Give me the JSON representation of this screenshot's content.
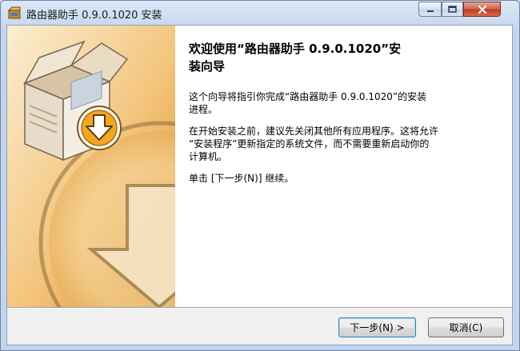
{
  "window": {
    "title": "路由器助手 0.9.0.1020 安装",
    "controls": [
      "minimize-icon",
      "maximize-icon",
      "close-icon"
    ]
  },
  "side_panel": {
    "image": "installer-box-with-download-arrow",
    "colors": {
      "bg_light": "#fbe6bd",
      "bg_dark": "#e2a54b",
      "arrow": "#e3a01e"
    }
  },
  "welcome": {
    "heading_line1": "欢迎使用“路由器助手 0.9.0.1020”安",
    "heading_line2": "装向导",
    "p1_line1": "这个向导将指引你完成“路由器助手 0.9.0.1020”的安装",
    "p1_line2": "进程。",
    "p2_line1": "在开始安装之前，建议先关闭其他所有应用程序。这将允许",
    "p2_line2": "“安装程序”更新指定的系统文件，而不需要重新启动你的",
    "p2_line3": "计算机。",
    "p3": "单击 [下一步(N)] 继续。"
  },
  "buttons": {
    "next": "下一步(N) >",
    "cancel": "取消(C)"
  }
}
